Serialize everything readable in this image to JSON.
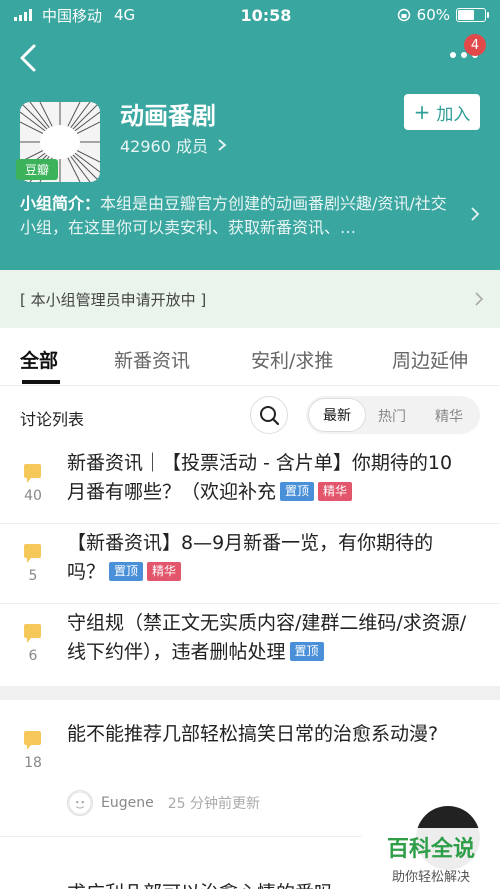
{
  "status_bar": {
    "carrier": "中国移动",
    "network": "4G",
    "time": "10:58",
    "battery": "60%",
    "battery_level": 0.6
  },
  "nav": {
    "notification_count": "4"
  },
  "group": {
    "name": "动画番剧",
    "members": "42960 成员",
    "tag": "豆瓣",
    "join_label": "加入",
    "intro_label": "小组简介：",
    "intro_text": "本组是由豆瓣官方创建的动画番剧兴趣/资讯/社交小组，在这里你可以卖安利、获取新番资讯、…"
  },
  "notice": "[ 本小组管理员申请开放中 ]",
  "tabs": [
    {
      "label": "全部",
      "active": true
    },
    {
      "label": "新番资讯",
      "active": false
    },
    {
      "label": "安利/求推",
      "active": false
    },
    {
      "label": "周边延伸",
      "active": false
    }
  ],
  "list": {
    "title": "讨论列表",
    "sort_options": [
      "最新",
      "热门",
      "精华"
    ],
    "active_sort": "最新"
  },
  "labels": {
    "pin": "置顶",
    "best": "精华"
  },
  "posts": [
    {
      "count": "40",
      "title": "新番资讯｜【投票活动 - 含片单】你期待的10月番有哪些？（欢迎补充"
    },
    {
      "count": "5",
      "title": "【新番资讯】8—9月新番一览，有你期待的吗？"
    },
    {
      "count": "6",
      "title": "守组规（禁正文无实质内容/建群二维码/求资源/线下约伴），违者删帖处理"
    },
    {
      "count": "18",
      "title": "能不能推荐几部轻松搞笑日常的治愈系动漫?",
      "author": "Eugene",
      "updated": "25 分钟前更新"
    }
  ],
  "partial_post_title": "求广利几部可以治愈心情的番吗",
  "watermark": {
    "big": "百科全说",
    "small": "助你轻松解决"
  },
  "colors": {
    "header_teal": "#3aa6a0",
    "join_text": "#2f9e97",
    "pin_blue": "#4a90d9",
    "best_red": "#e2556a",
    "bubble_yellow": "#f6c85a",
    "notice_bg": "#eaf4ea"
  }
}
